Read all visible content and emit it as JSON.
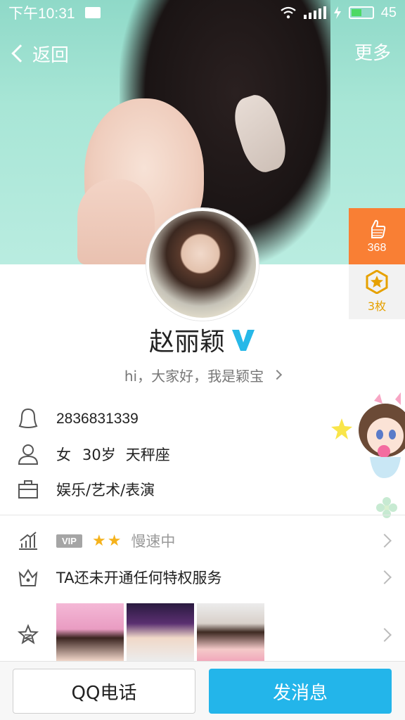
{
  "status_bar": {
    "time": "下午10:31",
    "battery": "45",
    "icons": [
      "message-icon",
      "wifi-icon",
      "signal-icon",
      "charging-icon",
      "battery-icon"
    ]
  },
  "nav": {
    "back_label": "返回",
    "more_label": "更多"
  },
  "side": {
    "likes_count": "368",
    "medal_count": "3枚",
    "likes_icon": "thumbs-up-icon",
    "medal_icon": "star-medal-icon"
  },
  "profile": {
    "name": "赵丽颖",
    "verified_badge": "V",
    "signature": "hi，大家好，我是颖宝",
    "qq_number": "2836831339",
    "gender": "女",
    "age": "30岁",
    "zodiac": "天秤座",
    "occupation": "娱乐/艺术/表演"
  },
  "list": {
    "vip_label": "VIP",
    "vip_speed": "慢速中",
    "privilege_text": "TA还未开通任何特权服务"
  },
  "actions": {
    "call_label": "QQ电话",
    "message_label": "发消息"
  },
  "colors": {
    "accent": "#23b5ea",
    "likes_bg": "#f97f34",
    "medal_color": "#e6a100",
    "star": "#f5b21b"
  }
}
